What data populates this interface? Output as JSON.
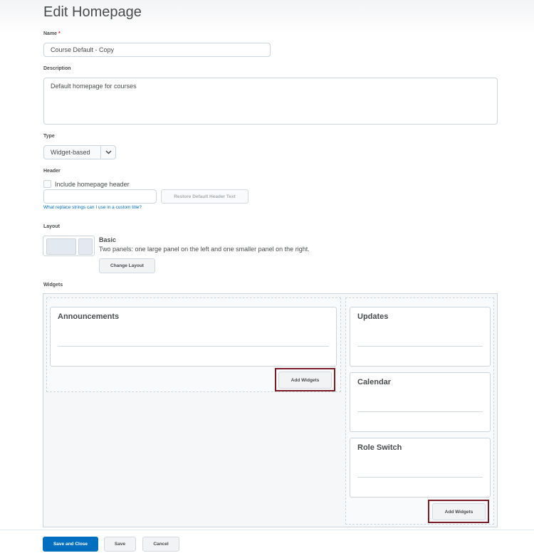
{
  "page": {
    "title": "Edit Homepage"
  },
  "name_field": {
    "label": "Name",
    "required_mark": "*",
    "value": "Course Default - Copy"
  },
  "description_field": {
    "label": "Description",
    "value": "Default homepage for courses"
  },
  "type_field": {
    "label": "Type",
    "selected": "Widget-based"
  },
  "header_section": {
    "label": "Header",
    "checkbox_label": "Include homepage header",
    "checkbox_checked": false,
    "header_text_value": "",
    "restore_button": "Restore Default Header Text",
    "help_link": "What replace strings can I use in a custom title?"
  },
  "layout_section": {
    "label": "Layout",
    "name": "Basic",
    "description": "Two panels: one large panel on the left and one smaller panel on the right.",
    "change_button": "Change Layout"
  },
  "widgets_section": {
    "label": "Widgets",
    "left_panel": {
      "widgets": [
        "Announcements"
      ],
      "add_button": "Add Widgets"
    },
    "right_panel": {
      "widgets": [
        "Updates",
        "Calendar",
        "Role Switch"
      ],
      "add_button": "Add Widgets"
    },
    "highlight_color": "#7b1b26"
  },
  "footer": {
    "save_close": "Save and Close",
    "save": "Save",
    "cancel": "Cancel"
  },
  "colors": {
    "primary": "#006fbf",
    "link": "#006fbf",
    "required": "#cd2026"
  }
}
